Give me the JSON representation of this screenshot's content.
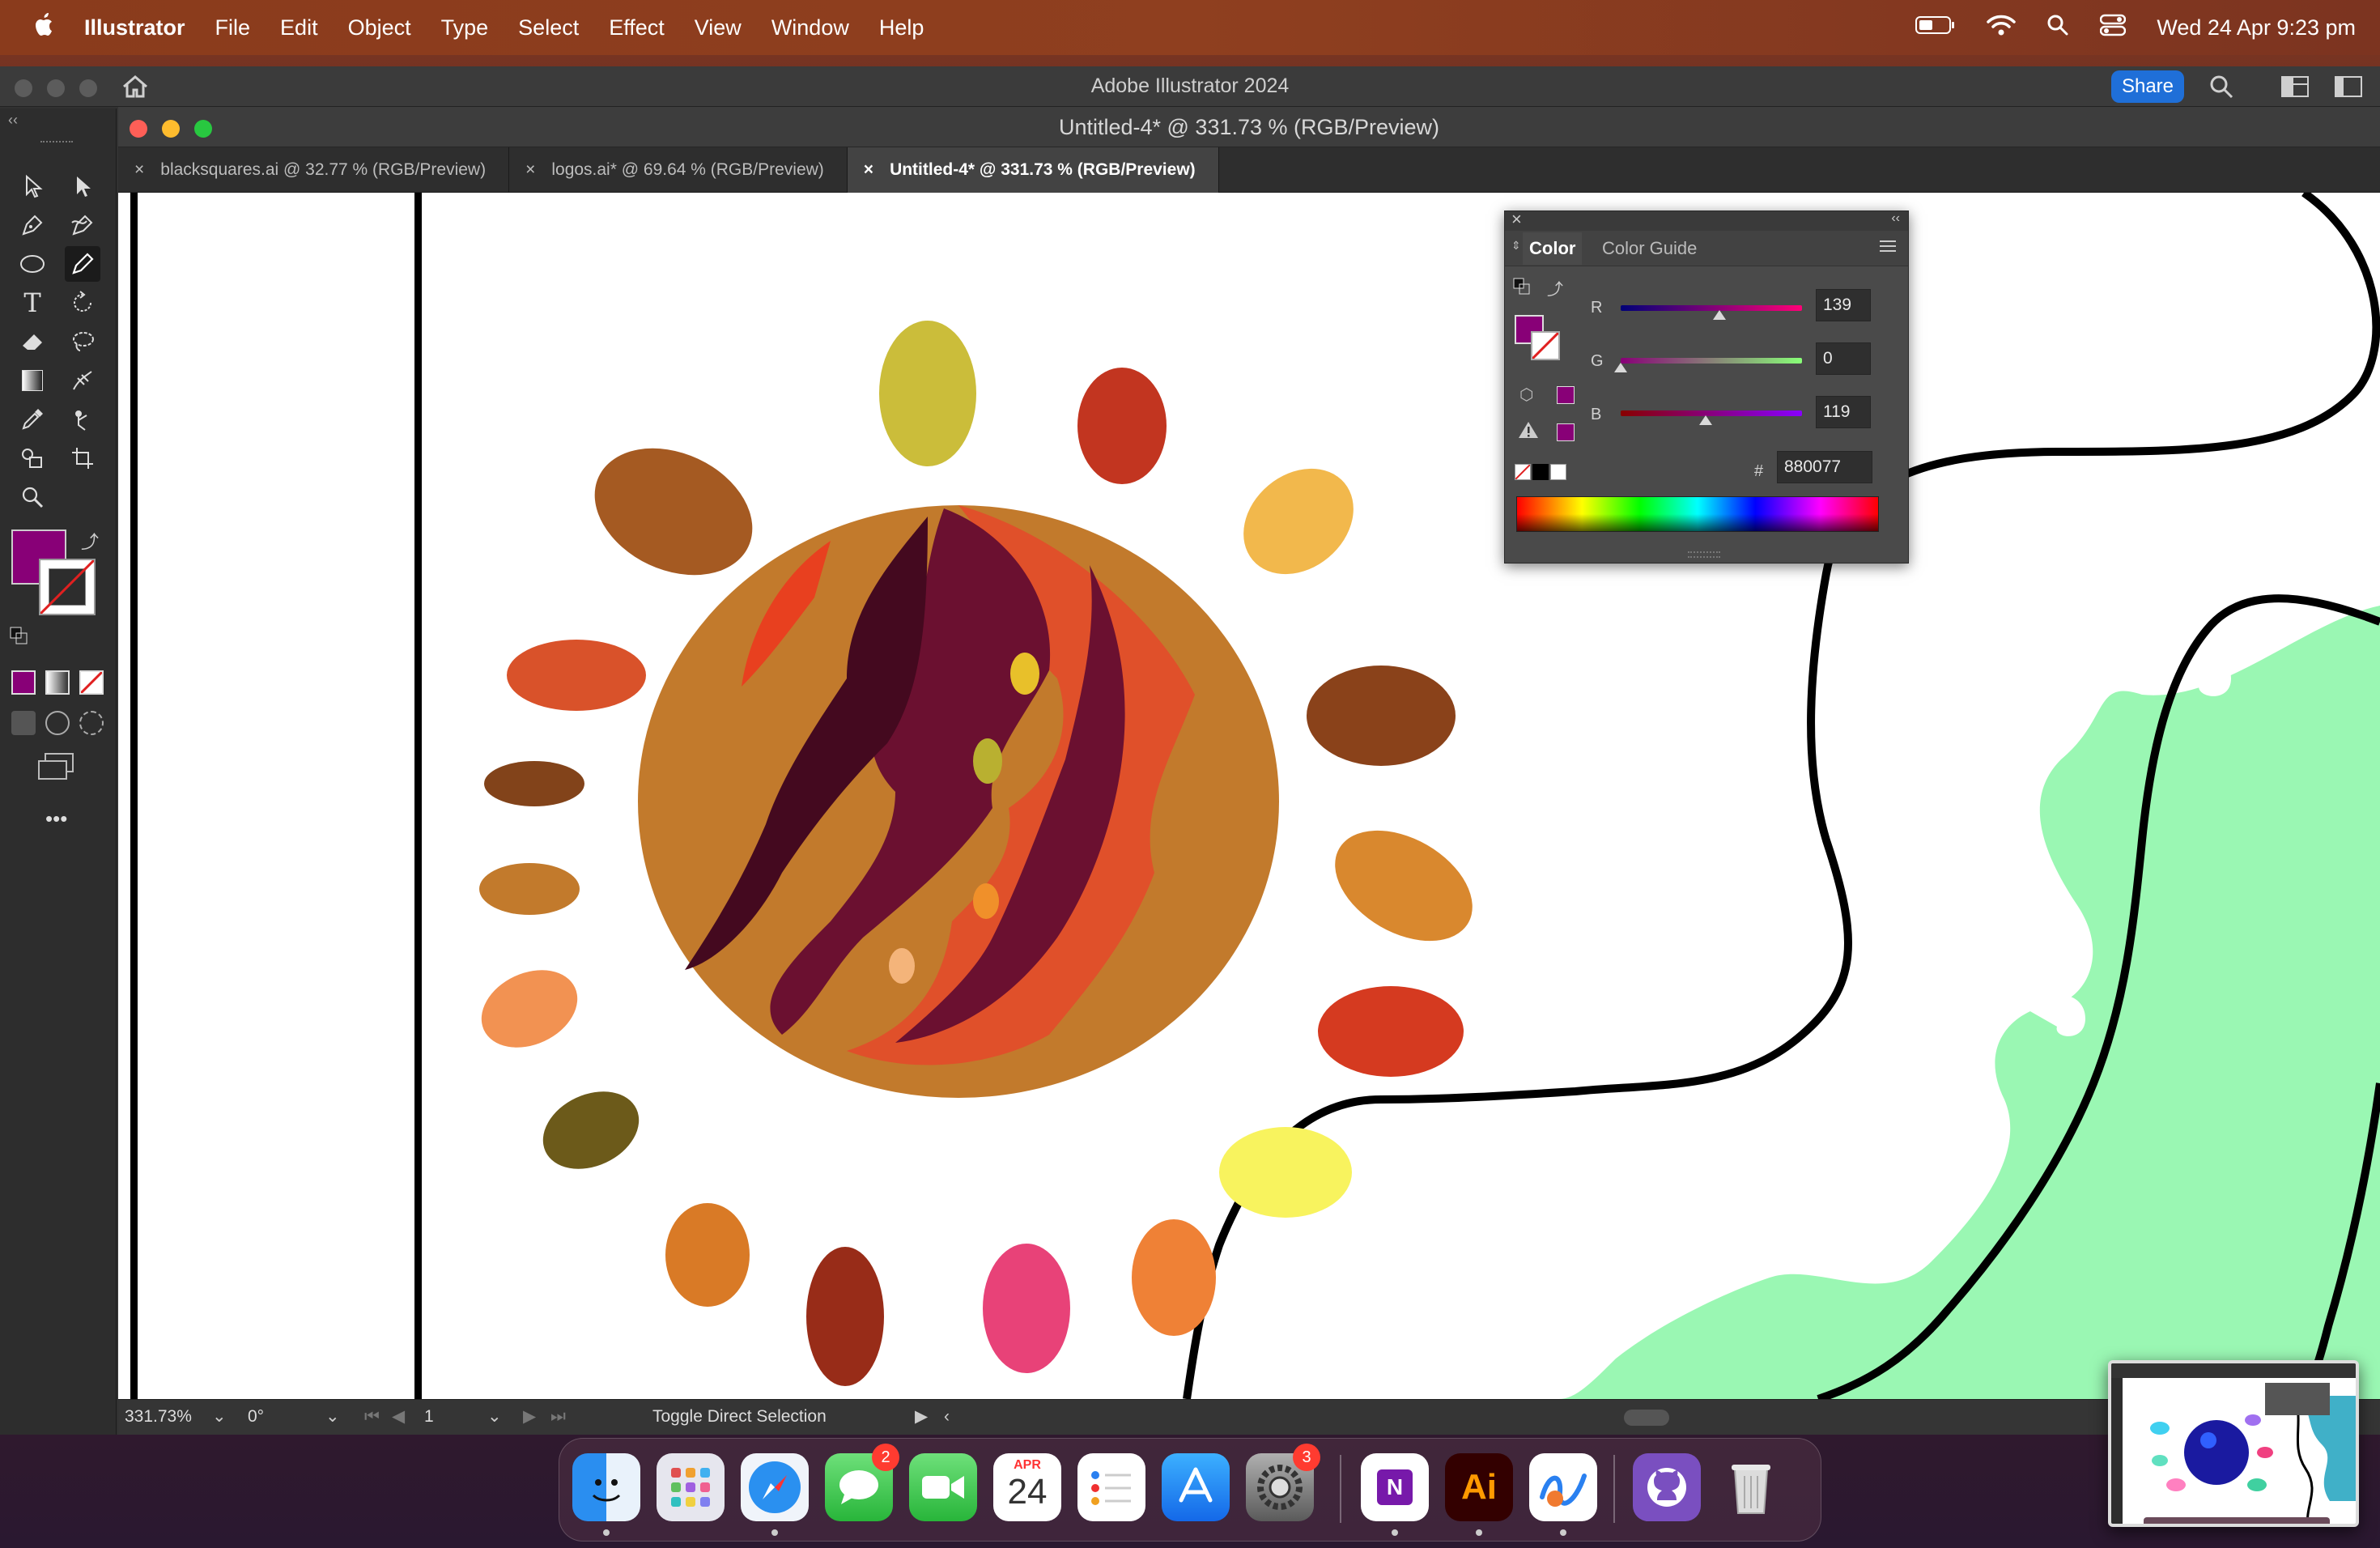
{
  "menubar": {
    "app_name": "Illustrator",
    "items": [
      "File",
      "Edit",
      "Object",
      "Type",
      "Select",
      "Effect",
      "View",
      "Window",
      "Help"
    ],
    "datetime": "Wed 24 Apr  9:23 pm",
    "icons": [
      "battery-icon",
      "wifi-icon",
      "spotlight-search-icon",
      "control-center-icon"
    ]
  },
  "app_window": {
    "title": "Adobe Illustrator 2024",
    "share_label": "Share"
  },
  "document": {
    "title": "Untitled-4* @ 331.73 % (RGB/Preview)",
    "tabs": [
      {
        "label": "blacksquares.ai @ 32.77 % (RGB/Preview)",
        "active": false
      },
      {
        "label": "logos.ai* @ 69.64 % (RGB/Preview)",
        "active": false
      },
      {
        "label": "Untitled-4* @ 331.73 % (RGB/Preview)",
        "active": true
      }
    ]
  },
  "toolbar": {
    "tools": [
      "selection-tool-icon",
      "direct-selection-tool-icon",
      "pen-tool-icon",
      "curvature-tool-icon",
      "ellipse-tool-icon",
      "pencil-tool-icon",
      "type-tool-icon",
      "rotate-tool-icon",
      "eraser-tool-icon",
      "lasso-tool-icon",
      "gradient-tool-icon",
      "width-tool-icon",
      "eyedropper-tool-icon",
      "puppet-warp-tool-icon",
      "shape-builder-tool-icon",
      "artboard-tool-icon",
      "zoom-tool-icon"
    ],
    "fill_color": "#880077",
    "more_label": "•••"
  },
  "color_panel": {
    "tab_color": "Color",
    "tab_guide": "Color Guide",
    "r_label": "R",
    "r_value": "139",
    "r": 139,
    "g_label": "G",
    "g_value": "0",
    "g": 0,
    "b_label": "B",
    "b_value": "119",
    "b": 119,
    "hex_label": "#",
    "hex_value": "880077",
    "fill_color": "#880077"
  },
  "statusbar": {
    "zoom": "331.73%",
    "rotation": "0°",
    "artboard": "1",
    "status_text": "Toggle Direct Selection"
  },
  "dock": {
    "apps": [
      {
        "name": "finder",
        "badge": "",
        "running": true
      },
      {
        "name": "launchpad",
        "badge": "",
        "running": false
      },
      {
        "name": "safari",
        "badge": "",
        "running": true
      },
      {
        "name": "messages",
        "badge": "2",
        "running": false
      },
      {
        "name": "facetime",
        "badge": "",
        "running": false
      },
      {
        "name": "calendar",
        "badge": "",
        "running": false
      },
      {
        "name": "reminders",
        "badge": "",
        "running": false
      },
      {
        "name": "app-store",
        "badge": "",
        "running": false
      },
      {
        "name": "system-settings",
        "badge": "3",
        "running": false
      },
      {
        "name": "onenote",
        "badge": "",
        "running": true
      },
      {
        "name": "illustrator",
        "badge": "",
        "running": true
      },
      {
        "name": "freeform",
        "badge": "",
        "running": true
      },
      {
        "name": "github-desktop",
        "badge": "",
        "running": false
      },
      {
        "name": "trash",
        "badge": "",
        "running": false
      }
    ],
    "calendar_month": "APR",
    "calendar_day": "24",
    "illustrator_label": "Ai",
    "onenote_label": "N"
  }
}
